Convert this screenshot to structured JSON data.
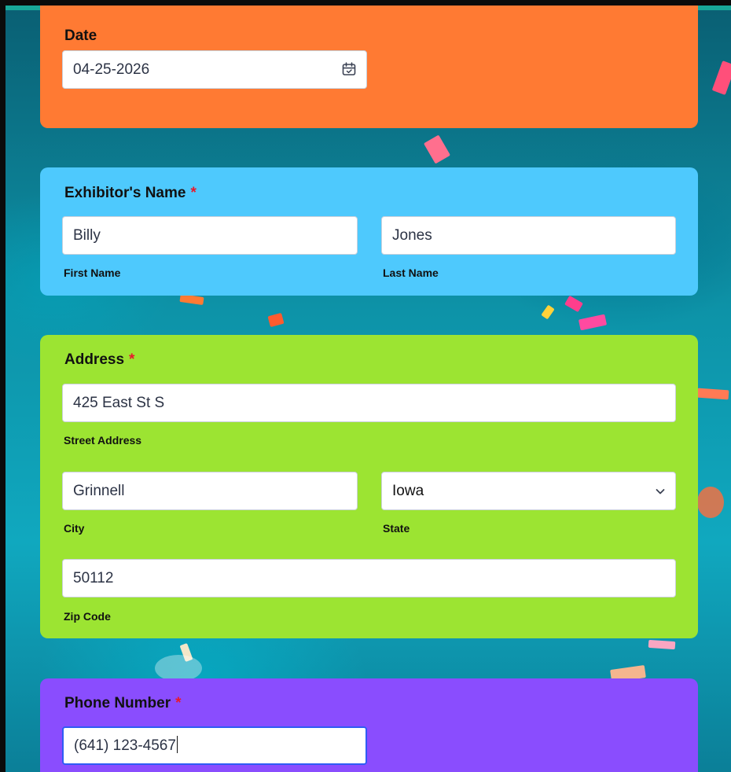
{
  "date": {
    "label": "Date",
    "value": "04-25-2026",
    "icon": "calendar-icon"
  },
  "exhibitor_name": {
    "label": "Exhibitor's Name",
    "required_mark": "*",
    "first_value": "Billy",
    "first_sublabel": "First Name",
    "last_value": "Jones",
    "last_sublabel": "Last Name"
  },
  "address": {
    "label": "Address",
    "required_mark": "*",
    "street_value": "425 East St S",
    "street_sublabel": "Street Address",
    "city_value": "Grinnell",
    "city_sublabel": "City",
    "state_value": "Iowa",
    "state_sublabel": "State",
    "zip_value": "50112",
    "zip_sublabel": "Zip Code"
  },
  "phone": {
    "label": "Phone Number",
    "required_mark": "*",
    "value": "(641) 123-4567"
  },
  "colors": {
    "date_card": "#ff7a33",
    "name_card": "#4ec9fd",
    "address_card": "#9ce432",
    "phone_card": "#8a4dfe",
    "required": "#e8192c",
    "focus_border": "#2e5cf5"
  }
}
